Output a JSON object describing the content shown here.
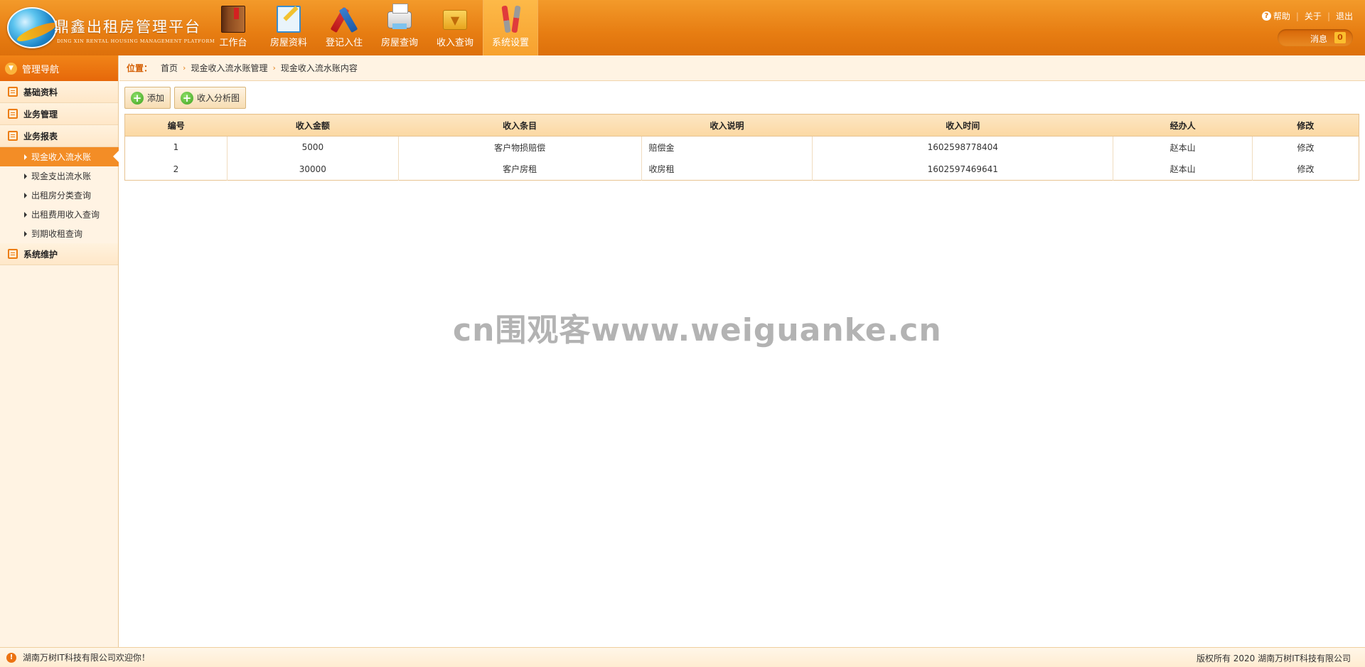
{
  "app": {
    "title": "鼎鑫出租房管理平台",
    "subtitle": "DING XIN RENTAL HOUSING MANAGEMENT PLATFORM"
  },
  "topnav": [
    {
      "label": "工作台",
      "icon": "workbench-book-icon"
    },
    {
      "label": "房屋资料",
      "icon": "house-docs-icon"
    },
    {
      "label": "登记入住",
      "icon": "checkin-pencil-icon"
    },
    {
      "label": "房屋查询",
      "icon": "printer-icon"
    },
    {
      "label": "收入查询",
      "icon": "folder-download-icon"
    },
    {
      "label": "系统设置",
      "icon": "tools-icon",
      "active": true
    }
  ],
  "toplinks": {
    "help": "帮助",
    "about": "关于",
    "logout": "退出"
  },
  "messages": {
    "label": "消息",
    "count": "0"
  },
  "sidebar": {
    "title": "管理导航",
    "groups": [
      {
        "label": "基础资料"
      },
      {
        "label": "业务管理"
      },
      {
        "label": "业务报表",
        "items": [
          {
            "label": "现金收入流水账",
            "active": true
          },
          {
            "label": "现金支出流水账"
          },
          {
            "label": "出租房分类查询"
          },
          {
            "label": "出租费用收入查询"
          },
          {
            "label": "到期收租查询"
          }
        ]
      },
      {
        "label": "系统维护"
      }
    ]
  },
  "breadcrumb": {
    "label": "位置：",
    "items": [
      "首页",
      "现金收入流水账管理",
      "现金收入流水账内容"
    ]
  },
  "toolbar": {
    "add_label": "添加",
    "chart_label": "收入分析图"
  },
  "table": {
    "headers": [
      "编号",
      "收入金额",
      "收入条目",
      "收入说明",
      "收入时间",
      "经办人",
      "修改"
    ],
    "rows": [
      [
        "1",
        "5000",
        "客户物损赔偿",
        "赔偿金",
        "1602598778404",
        "赵本山",
        "修改"
      ],
      [
        "2",
        "30000",
        "客户房租",
        "收房租",
        "1602597469641",
        "赵本山",
        "修改"
      ]
    ]
  },
  "watermark": "cn围观客www.weiguanke.cn",
  "footer": {
    "welcome": "湖南万树IT科技有限公司欢迎你！",
    "copyright": "版权所有 2020 湖南万树IT科技有限公司"
  },
  "colors": {
    "accent": "#e77d12",
    "active_nav": "#f7a12e",
    "sidebar_bg": "#fff3e3"
  }
}
